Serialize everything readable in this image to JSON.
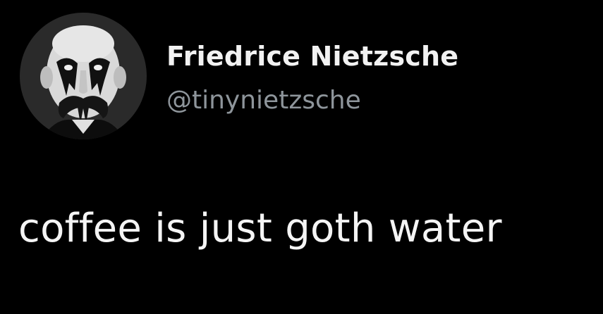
{
  "tweet": {
    "author": {
      "display_name": "Friedrice Nietzsche",
      "handle": "@tinynietzsche",
      "avatar_icon": "goth-portrait-avatar"
    },
    "text": "coffee is just goth water"
  },
  "colors": {
    "background": "#000000",
    "name": "#f2f2f2",
    "handle": "#8e959b",
    "text": "#f4f4f4"
  }
}
